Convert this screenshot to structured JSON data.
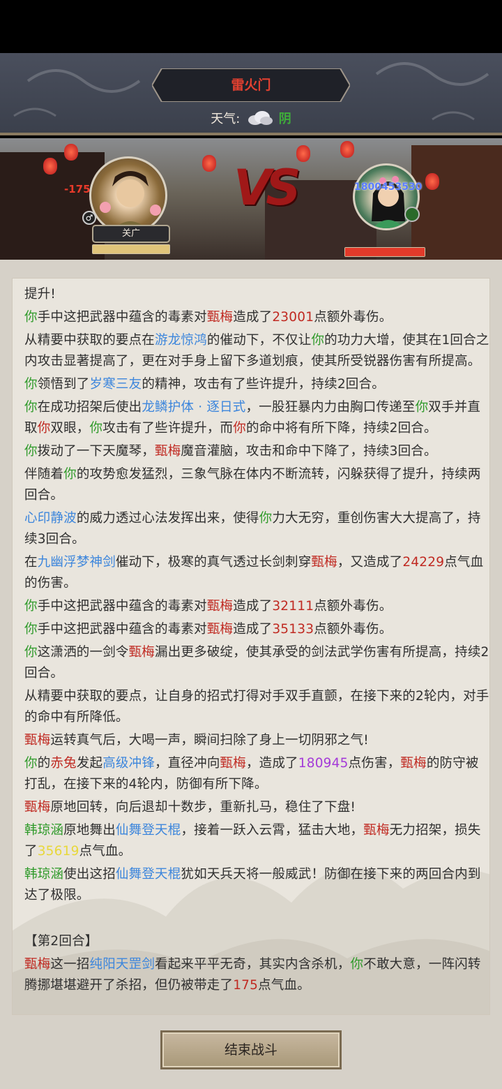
{
  "header": {
    "title": "雷火门",
    "weather_label": "天气:",
    "weather_value": "阴",
    "weather_icon": "cloud-icon"
  },
  "arena": {
    "player_damage": "-175",
    "player_name": "关广",
    "player_gender_icon": "male-icon",
    "player_hp_fraction": 1.0,
    "enemy_overlay_text": "1800453530",
    "enemy_hp_fraction": 1.0,
    "vs_text": "VS",
    "colors": {
      "hp_player": "#e0c47a",
      "hp_enemy": "#e23a2a"
    }
  },
  "log": {
    "lines": [
      [
        {
          "t": "提升!",
          "c": ""
        }
      ],
      [
        {
          "t": "你",
          "c": "g"
        },
        {
          "t": "手中这把武器中蕴含的毒素对",
          "c": ""
        },
        {
          "t": "甄梅",
          "c": "r"
        },
        {
          "t": "造成了",
          "c": ""
        },
        {
          "t": "23001",
          "c": "r"
        },
        {
          "t": "点额外毒伤。",
          "c": ""
        }
      ],
      [
        {
          "t": "从精要中获取的要点在",
          "c": ""
        },
        {
          "t": "游龙惊鸿",
          "c": "b"
        },
        {
          "t": "的催动下，不仅让",
          "c": ""
        },
        {
          "t": "你",
          "c": "g"
        },
        {
          "t": "的功力大增，使其在1回合之内攻击显著提高了，更在对手身上留下多道划痕，使其所受锐器伤害有所提高。",
          "c": ""
        }
      ],
      [
        {
          "t": "你",
          "c": "g"
        },
        {
          "t": "领悟到了",
          "c": ""
        },
        {
          "t": "岁寒三友",
          "c": "b"
        },
        {
          "t": "的精神，攻击有了些许提升，持续2回合。",
          "c": ""
        }
      ],
      [
        {
          "t": "你",
          "c": "g"
        },
        {
          "t": "在成功招架后使出",
          "c": ""
        },
        {
          "t": "龙鳞护体 · 逐日式",
          "c": "b"
        },
        {
          "t": "，一股狂暴内力由胸口传递至",
          "c": ""
        },
        {
          "t": "你",
          "c": "g"
        },
        {
          "t": "双手并直取",
          "c": ""
        },
        {
          "t": "你",
          "c": "r"
        },
        {
          "t": "双眼，",
          "c": ""
        },
        {
          "t": "你",
          "c": "g"
        },
        {
          "t": "攻击有了些许提升，而",
          "c": ""
        },
        {
          "t": "你",
          "c": "r"
        },
        {
          "t": "的命中将有所下降，持续2回合。",
          "c": ""
        }
      ],
      [
        {
          "t": "你",
          "c": "g"
        },
        {
          "t": "拨动了一下天魔琴，",
          "c": ""
        },
        {
          "t": "甄梅",
          "c": "r"
        },
        {
          "t": "魔音灌脑，攻击和命中下降了，持续3回合。",
          "c": ""
        }
      ],
      [
        {
          "t": "伴随着",
          "c": ""
        },
        {
          "t": "你",
          "c": "g"
        },
        {
          "t": "的攻势愈发猛烈，三象气脉在体内不断流转，闪躲获得了提升，持续两回合。",
          "c": ""
        }
      ],
      [
        {
          "t": "心印静波",
          "c": "b"
        },
        {
          "t": "的威力透过心法发挥出来，使得",
          "c": ""
        },
        {
          "t": "你",
          "c": "g"
        },
        {
          "t": "力大无穷，重创伤害大大提高了，持续3回合。",
          "c": ""
        }
      ],
      [
        {
          "t": "在",
          "c": ""
        },
        {
          "t": "九幽浮梦神剑",
          "c": "b"
        },
        {
          "t": "催动下，极寒的真气透过长剑刺穿",
          "c": ""
        },
        {
          "t": "甄梅",
          "c": "r"
        },
        {
          "t": "，又造成了",
          "c": ""
        },
        {
          "t": "24229",
          "c": "r"
        },
        {
          "t": "点气血的伤害。",
          "c": ""
        }
      ],
      [
        {
          "t": "你",
          "c": "g"
        },
        {
          "t": "手中这把武器中蕴含的毒素对",
          "c": ""
        },
        {
          "t": "甄梅",
          "c": "r"
        },
        {
          "t": "造成了",
          "c": ""
        },
        {
          "t": "32111",
          "c": "r"
        },
        {
          "t": "点额外毒伤。",
          "c": ""
        }
      ],
      [
        {
          "t": "你",
          "c": "g"
        },
        {
          "t": "手中这把武器中蕴含的毒素对",
          "c": ""
        },
        {
          "t": "甄梅",
          "c": "r"
        },
        {
          "t": "造成了",
          "c": ""
        },
        {
          "t": "35133",
          "c": "r"
        },
        {
          "t": "点额外毒伤。",
          "c": ""
        }
      ],
      [
        {
          "t": "你",
          "c": "g"
        },
        {
          "t": "这潇洒的一剑令",
          "c": ""
        },
        {
          "t": "甄梅",
          "c": "r"
        },
        {
          "t": "漏出更多破绽，使其承受的剑法武学伤害有所提高，持续2回合。",
          "c": ""
        }
      ],
      [
        {
          "t": "从精要中获取的要点，让自身的招式打得对手双手直颤，在接下来的2轮内，对手的命中有所降低。",
          "c": ""
        }
      ],
      [
        {
          "t": "甄梅",
          "c": "r"
        },
        {
          "t": "运转真气后，大喝一声，瞬间扫除了身上一切阴邪之气!",
          "c": ""
        }
      ],
      [
        {
          "t": "你",
          "c": "g"
        },
        {
          "t": "的",
          "c": ""
        },
        {
          "t": "赤兔",
          "c": "r"
        },
        {
          "t": "发起",
          "c": ""
        },
        {
          "t": "高级冲锋",
          "c": "b"
        },
        {
          "t": "，直径冲向",
          "c": ""
        },
        {
          "t": "甄梅",
          "c": "r"
        },
        {
          "t": "，造成了",
          "c": ""
        },
        {
          "t": "180945",
          "c": "p"
        },
        {
          "t": "点伤害，",
          "c": ""
        },
        {
          "t": "甄梅",
          "c": "r"
        },
        {
          "t": "的防守被打乱，在接下来的4轮内，防御有所下降。",
          "c": ""
        }
      ],
      [
        {
          "t": "甄梅",
          "c": "r"
        },
        {
          "t": "原地回转，向后退却十数步，重新扎马，稳住了下盘!",
          "c": ""
        }
      ],
      [
        {
          "t": "韩琼涵",
          "c": "g"
        },
        {
          "t": "原地舞出",
          "c": ""
        },
        {
          "t": "仙舞登天棍",
          "c": "b"
        },
        {
          "t": "，接着一跃入云霄，猛击大地，",
          "c": ""
        },
        {
          "t": "甄梅",
          "c": "r"
        },
        {
          "t": "无力招架，损失了",
          "c": ""
        },
        {
          "t": "35619",
          "c": "y"
        },
        {
          "t": "点气血。",
          "c": ""
        }
      ],
      [
        {
          "t": "韩琼涵",
          "c": "g"
        },
        {
          "t": "使出这招",
          "c": ""
        },
        {
          "t": "仙舞登天棍",
          "c": "b"
        },
        {
          "t": "犹如天兵天将一般威武！防御在接下来的两回合内到达了极限。",
          "c": ""
        }
      ],
      [
        {
          "t": "",
          "c": ""
        }
      ],
      [
        {
          "t": "【第2回合】",
          "c": ""
        }
      ],
      [
        {
          "t": "甄梅",
          "c": "r"
        },
        {
          "t": "这一招",
          "c": ""
        },
        {
          "t": "纯阳天罡剑",
          "c": "b"
        },
        {
          "t": "看起来平平无奇，其实内含杀机，",
          "c": ""
        },
        {
          "t": "你",
          "c": "g"
        },
        {
          "t": "不敢大意，一阵闪转腾挪堪堪避开了杀招，但仍被带走了",
          "c": ""
        },
        {
          "t": "175",
          "c": "r"
        },
        {
          "t": "点气血。",
          "c": ""
        }
      ]
    ]
  },
  "footer": {
    "end_button": "结束战斗"
  }
}
